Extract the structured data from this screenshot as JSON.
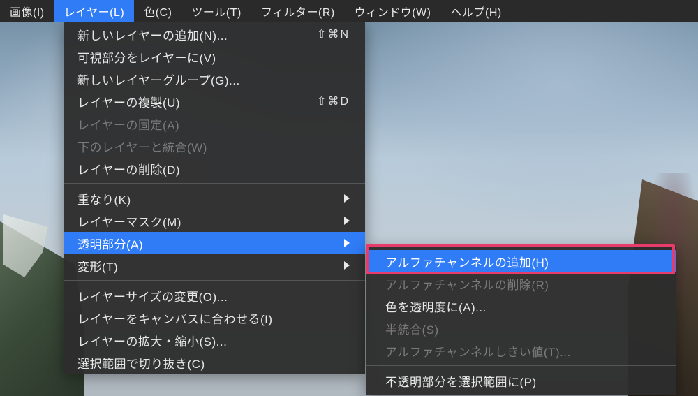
{
  "menubar": {
    "items": [
      {
        "label": "画像(I)",
        "selected": false
      },
      {
        "label": "レイヤー(L)",
        "selected": true
      },
      {
        "label": "色(C)",
        "selected": false
      },
      {
        "label": "ツール(T)",
        "selected": false
      },
      {
        "label": "フィルター(R)",
        "selected": false
      },
      {
        "label": "ウィンドウ(W)",
        "selected": false
      },
      {
        "label": "ヘルプ(H)",
        "selected": false
      }
    ]
  },
  "dropdown": {
    "items": [
      {
        "label": "新しいレイヤーの追加(N)...",
        "shortcut": "⇧⌘N",
        "type": "item"
      },
      {
        "label": "可視部分をレイヤーに(V)",
        "type": "item"
      },
      {
        "label": "新しいレイヤーグループ(G)...",
        "type": "item"
      },
      {
        "label": "レイヤーの複製(U)",
        "shortcut": "⇧⌘D",
        "type": "item"
      },
      {
        "label": "レイヤーの固定(A)",
        "type": "item",
        "disabled": true
      },
      {
        "label": "下のレイヤーと統合(W)",
        "type": "item",
        "disabled": true
      },
      {
        "label": "レイヤーの削除(D)",
        "type": "item"
      },
      {
        "type": "separator"
      },
      {
        "label": "重なり(K)",
        "type": "submenu"
      },
      {
        "label": "レイヤーマスク(M)",
        "type": "submenu"
      },
      {
        "label": "透明部分(A)",
        "type": "submenu",
        "highlighted": true
      },
      {
        "label": "変形(T)",
        "type": "submenu"
      },
      {
        "type": "separator"
      },
      {
        "label": "レイヤーサイズの変更(O)...",
        "type": "item"
      },
      {
        "label": "レイヤーをキャンバスに合わせる(I)",
        "type": "item"
      },
      {
        "label": "レイヤーの拡大・縮小(S)...",
        "type": "item"
      },
      {
        "label": "選択範囲で切り抜き(C)",
        "type": "item"
      }
    ]
  },
  "submenu": {
    "items": [
      {
        "label": "アルファチャンネルの追加(H)",
        "highlighted": true
      },
      {
        "label": "アルファチャンネルの削除(R)",
        "disabled": true
      },
      {
        "label": "色を透明度に(A)...",
        "disabled": false
      },
      {
        "label": "半統合(S)",
        "disabled": true
      },
      {
        "label": "アルファチャンネルしきい値(T)...",
        "disabled": true
      },
      {
        "type": "separator"
      },
      {
        "label": "不透明部分を選択範囲に(P)"
      }
    ]
  }
}
